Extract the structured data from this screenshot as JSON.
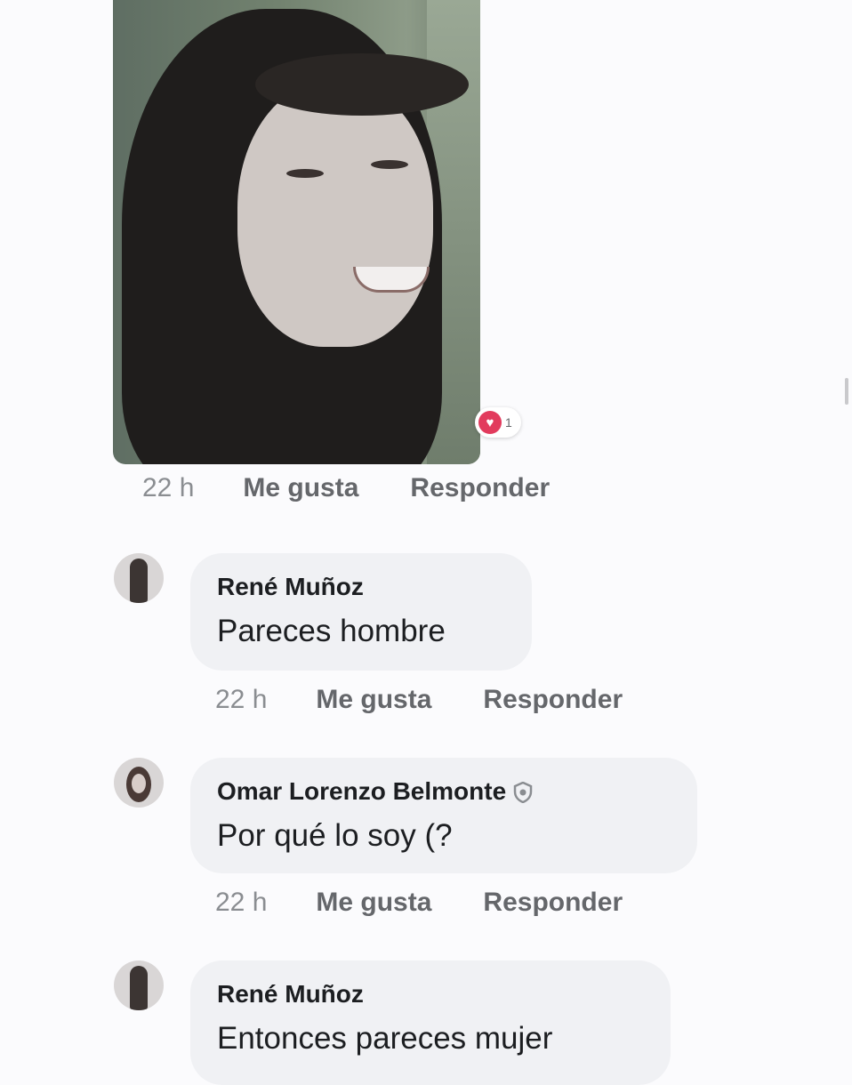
{
  "post": {
    "reaction_count": "1",
    "meta": {
      "time": "22 h",
      "like": "Me gusta",
      "reply": "Responder"
    }
  },
  "comments": [
    {
      "author": "René Muñoz",
      "text": "Pareces hombre",
      "meta": {
        "time": "22 h",
        "like": "Me gusta",
        "reply": "Responder"
      }
    },
    {
      "author": "Omar Lorenzo Belmonte",
      "text": "Por qué lo soy (?",
      "meta": {
        "time": "22 h",
        "like": "Me gusta",
        "reply": "Responder"
      }
    },
    {
      "author": "René Muñoz",
      "text": "Entonces pareces mujer"
    }
  ],
  "colors": {
    "heart": "#e23b5d",
    "bubble": "#f0f1f4",
    "meta_text": "#65676b"
  },
  "icons": [
    "heart-icon",
    "shield-badge-icon"
  ]
}
